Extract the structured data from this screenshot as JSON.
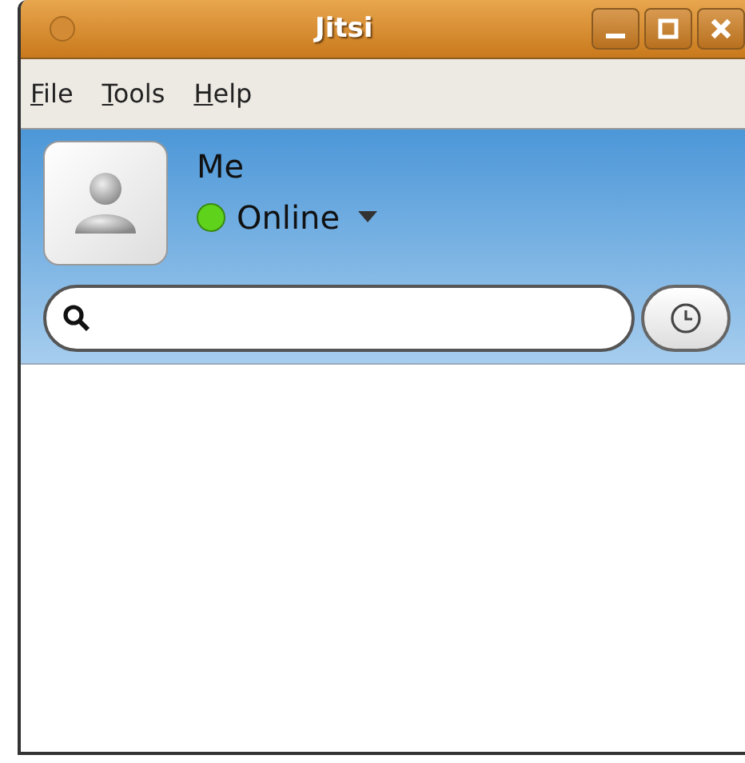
{
  "window": {
    "title": "Jitsi"
  },
  "menu": [
    {
      "label": "File"
    },
    {
      "label": "Tools"
    },
    {
      "label": "Help"
    }
  ],
  "account": {
    "name": "Me",
    "status": {
      "label": "Online",
      "kind": "online"
    }
  }
}
